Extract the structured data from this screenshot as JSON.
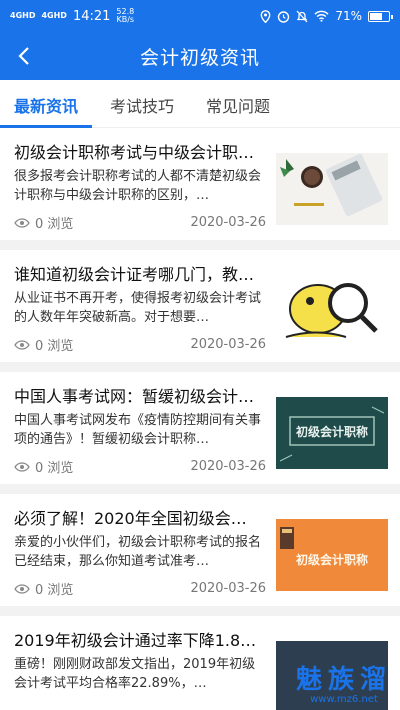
{
  "status": {
    "signal1": "4GHD",
    "signal2": "4GHD",
    "time": "14:21",
    "speed_value": "52.8",
    "speed_unit": "KB/s",
    "battery": "71%",
    "battery_level": 0.71
  },
  "header": {
    "title": "会计初级资讯"
  },
  "tabs": [
    {
      "label": "最新资讯"
    },
    {
      "label": "考试技巧"
    },
    {
      "label": "常见问题"
    }
  ],
  "articles": [
    {
      "title": "初级会计职称考试与中级会计职…",
      "summary": "很多报考会计职称考试的人都不清楚初级会计职称与中级会计职称的区别，…",
      "views": "0 浏览",
      "date": "2020-03-26",
      "thumb_text": ""
    },
    {
      "title": "谁知道初级会计证考哪几门，教…",
      "summary": "从业证书不再开考，使得报考初级会计考试的人数年年突破新高。对于想要…",
      "views": "0 浏览",
      "date": "2020-03-26",
      "thumb_text": ""
    },
    {
      "title": "中国人事考试网：暂缓初级会计…",
      "summary": "中国人事考试网发布《疫情防控期间有关事项的通告》！暂缓初级会计职称…",
      "views": "0 浏览",
      "date": "2020-03-26",
      "thumb_text": "初级会计职称"
    },
    {
      "title": "必须了解！2020年全国初级会…",
      "summary": "亲爱的小伙伴们，初级会计职称考试的报名已经结束，那么你知道考试准考…",
      "views": "0 浏览",
      "date": "2020-03-26",
      "thumb_text": "初级会计职称"
    },
    {
      "title": "2019年初级会计通过率下降1.8…",
      "summary": "重磅！刚刚财政部发文指出，2019年初级会计考试平均合格率22.89%，…",
      "views": "",
      "date": "",
      "thumb_text": ""
    }
  ],
  "watermark": {
    "main": "魅族溜",
    "url": "www.mz6.net"
  },
  "colors": {
    "primary": "#1a73e8"
  }
}
